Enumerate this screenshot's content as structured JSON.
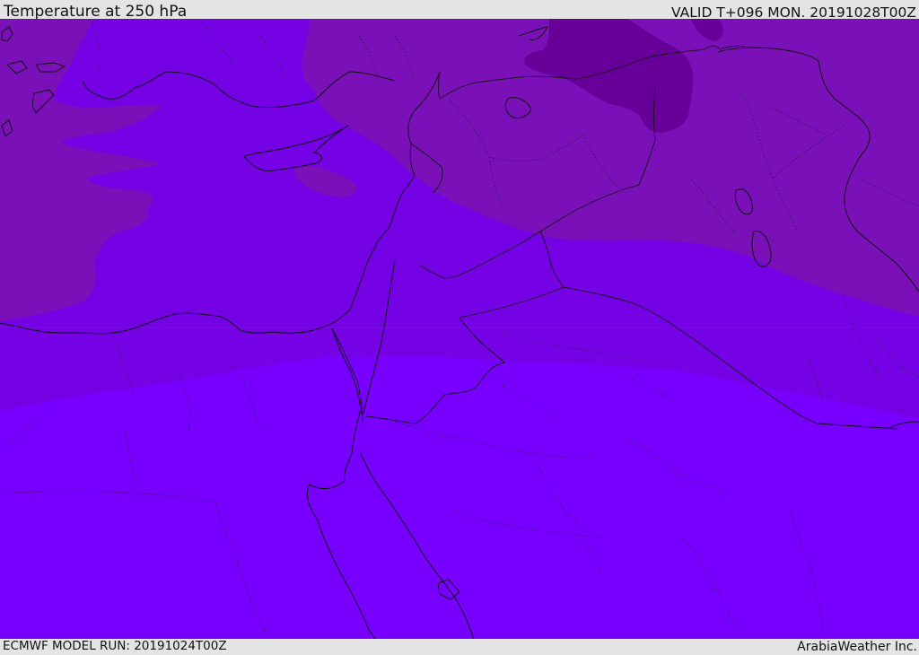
{
  "header": {
    "title": "Temperature at 250 hPa",
    "valid_time": "VALID T+096 MON. 20191028T00Z"
  },
  "footer": {
    "model_run": "ECMWF MODEL RUN: 20191024T00Z",
    "credit": "ArabiaWeather Inc."
  },
  "map": {
    "variable": "Temperature",
    "level": "250 hPa",
    "colors": {
      "warmest_band": "#7700ff",
      "mid_band": "#7402e4",
      "cool_band": "#7a10b8",
      "coldest_band": "#660099",
      "coastline": "#111111",
      "borders": "#222222"
    }
  }
}
